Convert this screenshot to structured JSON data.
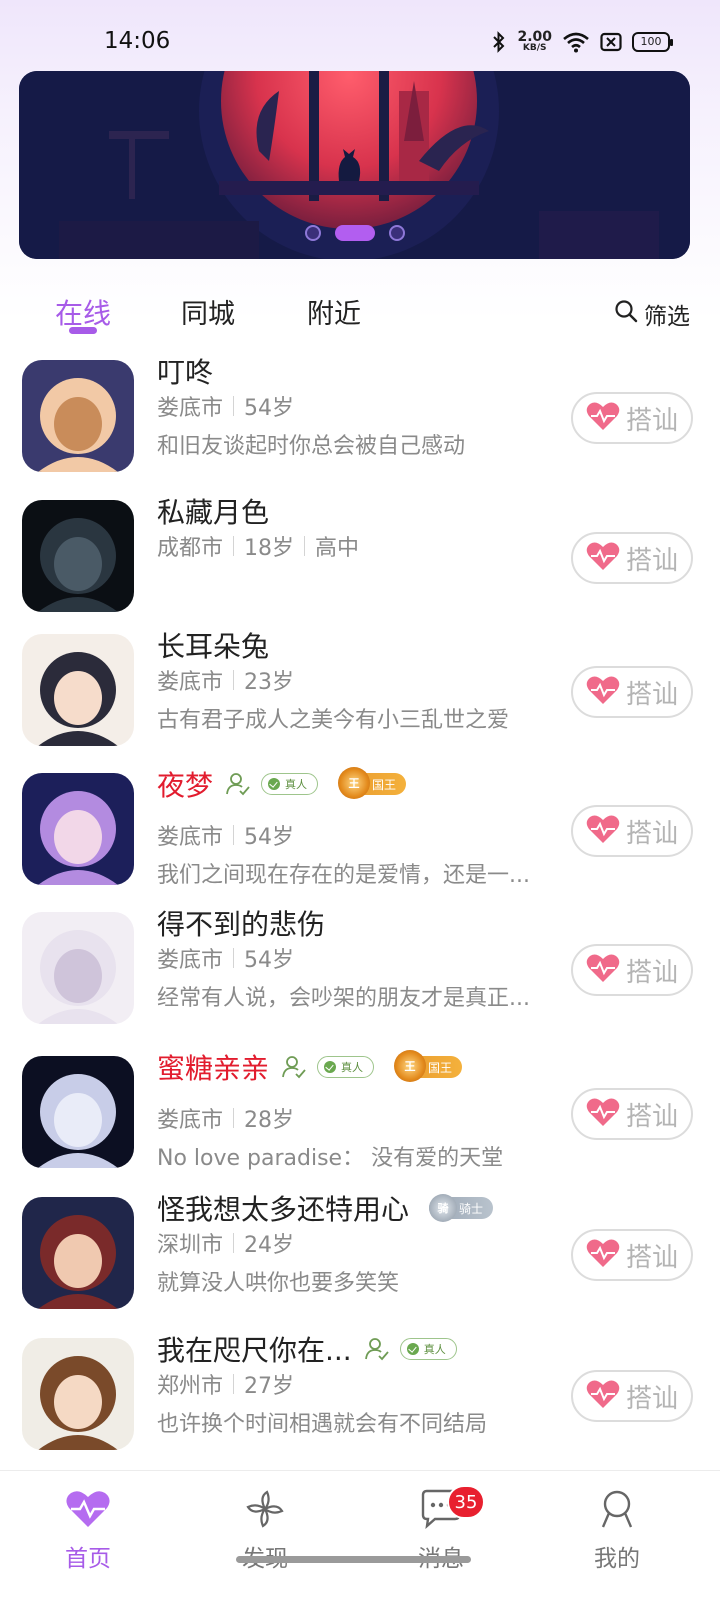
{
  "status_bar": {
    "time": "14:06",
    "net_speed_value": "2.00",
    "net_speed_unit": "KB/S",
    "battery": "100",
    "icons": [
      "bluetooth-icon",
      "wifi-icon",
      "sim-off-icon",
      "battery-icon"
    ]
  },
  "banner": {
    "slides": 3,
    "active_index": 1
  },
  "tabs": {
    "items": [
      "在线",
      "同城",
      "附近"
    ],
    "active_index": 0,
    "filter_label": "筛选"
  },
  "users": [
    {
      "name": "叮咚",
      "city": "娄底市",
      "age": "54岁",
      "extra": "",
      "signature": "和旧友谈起时你总会被自己感动",
      "vip": false,
      "badges": []
    },
    {
      "name": "私藏月色",
      "city": "成都市",
      "age": "18岁",
      "extra": "高中",
      "signature": "",
      "vip": false,
      "badges": []
    },
    {
      "name": "长耳朵兔",
      "city": "娄底市",
      "age": "23岁",
      "extra": "",
      "signature": "古有君子成人之美今有小三乱世之爱",
      "vip": false,
      "badges": []
    },
    {
      "name": "夜梦",
      "city": "娄底市",
      "age": "54岁",
      "extra": "",
      "signature": "我们之间现在存在的是爱情，还是一...",
      "vip": true,
      "badges": [
        "person",
        "real",
        "king"
      ]
    },
    {
      "name": "得不到的悲伤",
      "city": "娄底市",
      "age": "54岁",
      "extra": "",
      "signature": "经常有人说，会吵架的朋友才是真正...",
      "vip": false,
      "badges": []
    },
    {
      "name": "蜜糖亲亲",
      "city": "娄底市",
      "age": "28岁",
      "extra": "",
      "signature": "No love paradise： 没有爱的天堂",
      "vip": true,
      "badges": [
        "person",
        "real",
        "king"
      ]
    },
    {
      "name": "怪我想太多还特用心",
      "city": "深圳市",
      "age": "24岁",
      "extra": "",
      "signature": "就算没人哄你也要多笑笑",
      "vip": false,
      "badges": [
        "knight"
      ]
    },
    {
      "name": "我在咫尺你在...",
      "city": "郑州市",
      "age": "27岁",
      "extra": "",
      "signature": "也许换个时间相遇就会有不同结局",
      "vip": false,
      "badges": [
        "person",
        "real"
      ]
    }
  ],
  "badges": {
    "real_label": "真人",
    "king_label": "国王",
    "king_crest": "王",
    "knight_label": "骑士",
    "knight_crest": "骑"
  },
  "greet_label": "搭讪",
  "bottom_nav": {
    "items": [
      {
        "label": "首页",
        "icon": "heart-pulse-icon"
      },
      {
        "label": "发现",
        "icon": "pinwheel-icon"
      },
      {
        "label": "消息",
        "icon": "chat-icon",
        "badge": "35"
      },
      {
        "label": "我的",
        "icon": "profile-icon"
      }
    ],
    "active_index": 0
  },
  "colors": {
    "accent": "#a75be8",
    "vip_name": "#e21c2e",
    "greet_heart": "#f06a8a",
    "badge_red": "#e8202f"
  }
}
